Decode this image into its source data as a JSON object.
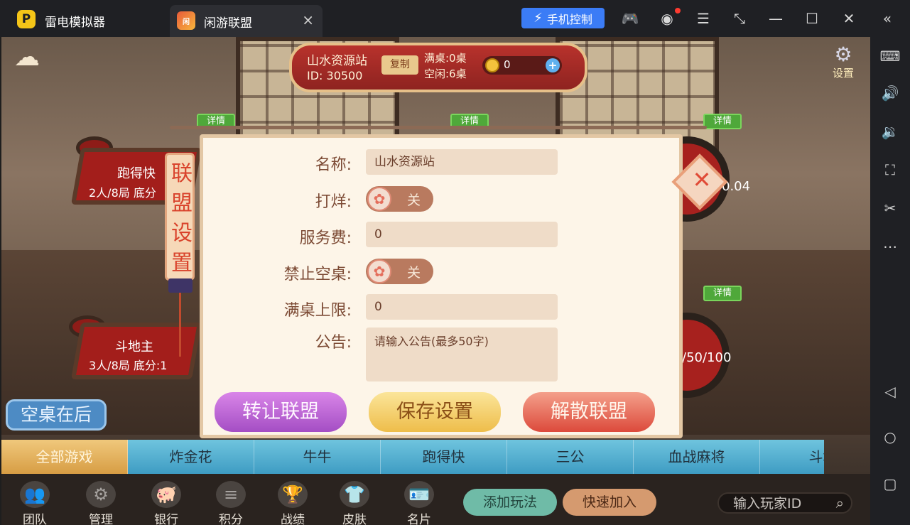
{
  "emulator": {
    "app_name": "雷电模拟器",
    "tab_title": "闲游联盟",
    "tab_close": "×",
    "phone_control": "手机控制",
    "icons": [
      "gamepad-icon",
      "user-icon",
      "menu-icon",
      "shrink-icon",
      "minimize-icon",
      "maximize-icon",
      "close-icon",
      "collapse-icon"
    ],
    "sidebar_icons": [
      "keyboard-icon",
      "volume-up-icon",
      "volume-down-icon",
      "fullscreen-icon",
      "scissors-icon",
      "more-icon",
      "back-icon",
      "home-icon",
      "recents-icon"
    ]
  },
  "header": {
    "club_name": "山水资源站",
    "club_id": "ID: 30500",
    "copy_label": "复制",
    "tables_full": "满桌:0桌",
    "tables_idle": "空闲:6桌",
    "coins": "0",
    "settings_label": "设置"
  },
  "tables": {
    "detail_label": "详情",
    "t1_name": "跑得快",
    "t1_info": "2人/8局 底分",
    "t2_name": "斗地主",
    "t2_info": "3人/8局 底分:1",
    "right1_text": "0.04",
    "right2_text": "/50/100"
  },
  "empty_back": "空桌在后",
  "game_tabs": [
    "全部游戏",
    "炸金花",
    "牛牛",
    "跑得快",
    "三公",
    "血战麻将",
    "斗地"
  ],
  "dock": {
    "items": [
      "团队",
      "管理",
      "银行",
      "积分",
      "战绩",
      "皮肤",
      "名片"
    ],
    "add_play": "添加玩法",
    "quick_join": "快速加入",
    "search_placeholder": "输入玩家ID"
  },
  "modal": {
    "scroll_title": "联盟设置",
    "name_label": "名称:",
    "name_value": "山水资源站",
    "closed_label": "打烊:",
    "closed_state": "关",
    "fee_label": "服务费:",
    "fee_value": "0",
    "no_empty_label": "禁止空桌:",
    "no_empty_state": "关",
    "full_limit_label": "满桌上限:",
    "full_limit_value": "0",
    "notice_label": "公告:",
    "notice_placeholder": "请输入公告(最多50字)",
    "transfer_button": "转让联盟",
    "save_button": "保存设置",
    "dissolve_button": "解散联盟"
  },
  "colors": {
    "accent_blue": "#3b7cf6",
    "banner_red": "#b8322c",
    "panel_bg": "#fdf5e8",
    "label_brown": "#7c4a34"
  }
}
